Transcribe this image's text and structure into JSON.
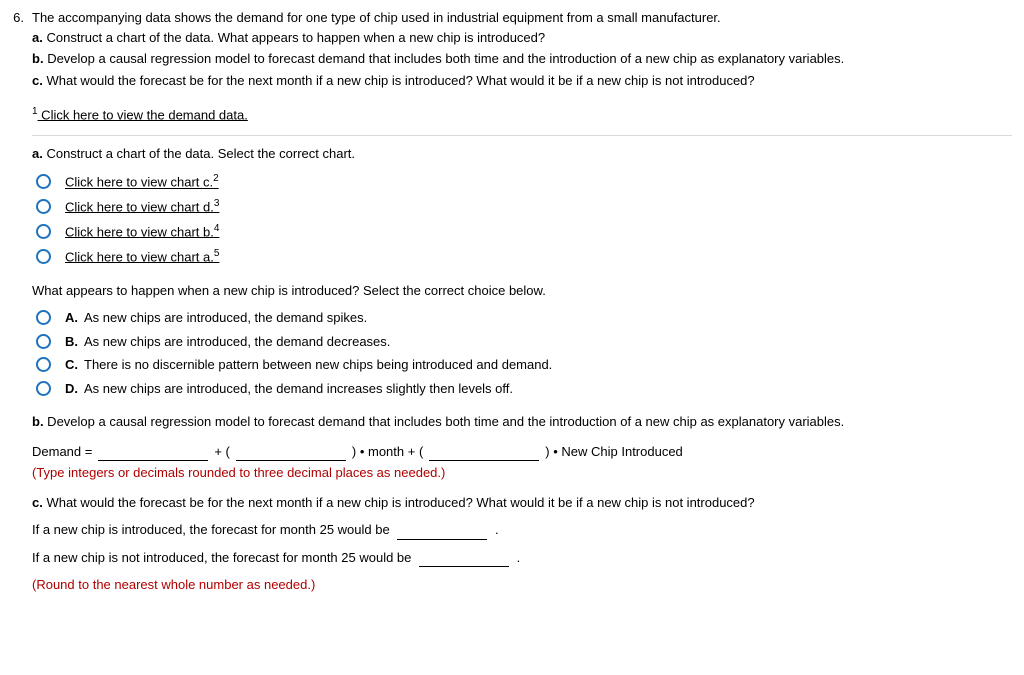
{
  "question": {
    "number": "6.",
    "stem": "The accompanying data shows the demand for one type of chip used in industrial equipment from a small manufacturer.",
    "parts": {
      "a_label": "a.",
      "a_text": "Construct a chart of the data. What appears to happen when a new chip is introduced?",
      "b_label": "b.",
      "b_text": "Develop a causal regression model to forecast demand that includes both time and the introduction of a new chip as explanatory variables.",
      "c_label": "c.",
      "c_text": "What would the forecast be for the next month if a new chip is introduced? What would it be if a new chip is not introduced?"
    },
    "footnote_sup": "1",
    "footnote_text": " Click here to view the demand data."
  },
  "partA": {
    "prompt_label": "a.",
    "prompt_text": " Construct a chart of the data. Select the correct chart.",
    "options": [
      {
        "text": "Click here to view chart c.",
        "sup": "2"
      },
      {
        "text": "Click here to view chart d.",
        "sup": "3"
      },
      {
        "text": "Click here to view chart b.",
        "sup": "4"
      },
      {
        "text": "Click here to view chart a.",
        "sup": "5"
      }
    ],
    "followup": "What appears to happen when a new chip is introduced? Select the correct choice below.",
    "choices": [
      {
        "label": "A.",
        "text": "As new chips are introduced, the demand spikes."
      },
      {
        "label": "B.",
        "text": "As new chips are introduced, the demand decreases."
      },
      {
        "label": "C.",
        "text": "There is no discernible pattern between new chips being introduced and demand."
      },
      {
        "label": "D.",
        "text": "As new chips are introduced, the demand increases slightly then levels off."
      }
    ]
  },
  "partB": {
    "label": "b.",
    "text": " Develop a causal regression model to forecast demand that includes both time and the introduction of a new chip as explanatory variables.",
    "eq": {
      "lhs": "Demand =",
      "plus_open": "+ (",
      "close_month": ") • month + (",
      "close_chip": ") • New Chip Introduced"
    },
    "hint": "(Type integers or decimals rounded to three decimal places as needed.)"
  },
  "partC": {
    "label": "c.",
    "text": " What would the forecast be for the next month if a new chip is introduced? What would it be if a new chip is not introduced?",
    "line1": "If a new chip is introduced, the forecast for month 25 would be ",
    "line1_end": ".",
    "line2": "If a new chip is not introduced, the forecast for month 25 would be ",
    "line2_end": ".",
    "hint": "(Round to the nearest whole number as needed.)"
  }
}
